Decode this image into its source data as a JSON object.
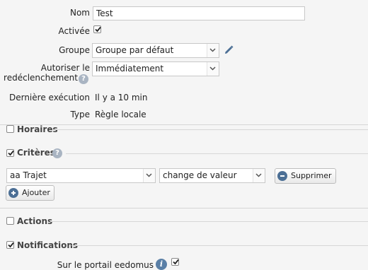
{
  "form": {
    "nom_label": "Nom",
    "nom_value": "Test",
    "activee_label": "Activée",
    "groupe_label": "Groupe",
    "groupe_value": "Groupe par défaut",
    "autoriser_label_line1": "Autoriser le",
    "autoriser_label_line2": "redéclenchement",
    "autoriser_value": "Immédiatement",
    "derniere_label": "Dernière exécution",
    "derniere_value": "Il y a 10 min",
    "type_label": "Type",
    "type_value": "Règle locale"
  },
  "sections": {
    "horaires": "Horaires",
    "criteres": "Critères",
    "actions": "Actions",
    "notifications": "Notifications"
  },
  "criteria": {
    "device_value": "aa Trajet",
    "condition_value": "change de valeur",
    "delete_label": "Supprimer",
    "add_label": "Ajouter"
  },
  "notifications": {
    "portail_label": "Sur le portail eedomus"
  },
  "icons": {
    "help": "help-icon",
    "edit": "pencil-icon",
    "info": "info-icon"
  },
  "colors": {
    "background": "#f5f5f5",
    "accent": "#4c6f95"
  }
}
